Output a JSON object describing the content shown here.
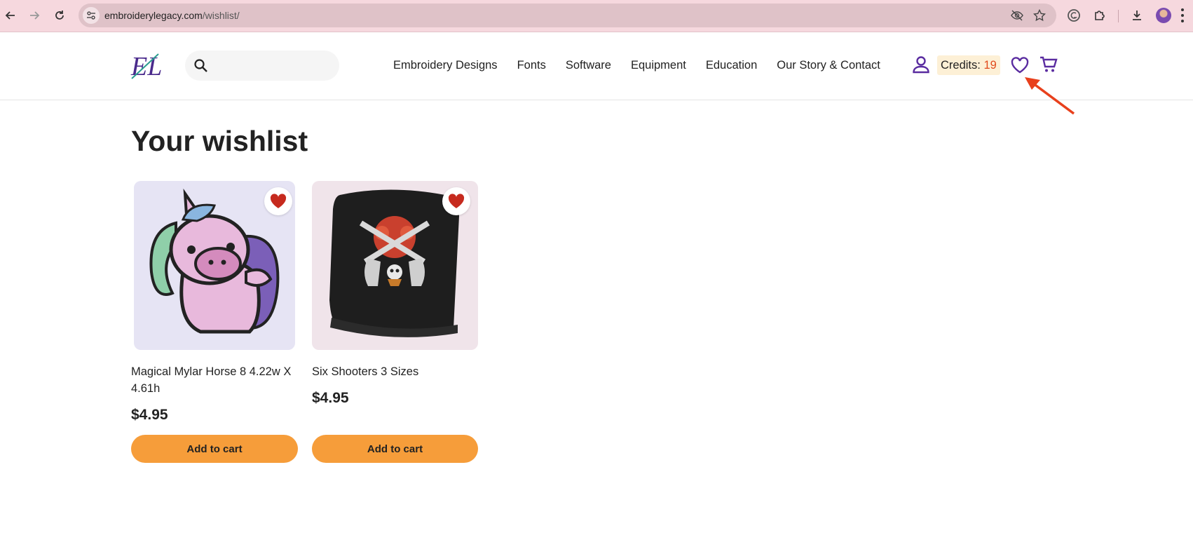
{
  "browser": {
    "url_domain": "embroiderylegacy.com",
    "url_path": "/wishlist/"
  },
  "header": {
    "search_placeholder": "",
    "nav_items": [
      "Embroidery Designs",
      "Fonts",
      "Software",
      "Equipment",
      "Education",
      "Our Story & Contact"
    ],
    "credits_label": "Credits:",
    "credits_value": "19"
  },
  "page": {
    "title": "Your wishlist"
  },
  "products": [
    {
      "name": "Magical Mylar Horse 8 4.22w X 4.61h",
      "price": "$4.95",
      "button": "Add to cart"
    },
    {
      "name": "Six Shooters 3 Sizes",
      "price": "$4.95",
      "button": "Add to cart"
    }
  ],
  "colors": {
    "brand_purple": "#5a2ca0",
    "accent_orange": "#f69d3a",
    "heart_red": "#c62a1e",
    "annotation_arrow": "#e8401c"
  }
}
